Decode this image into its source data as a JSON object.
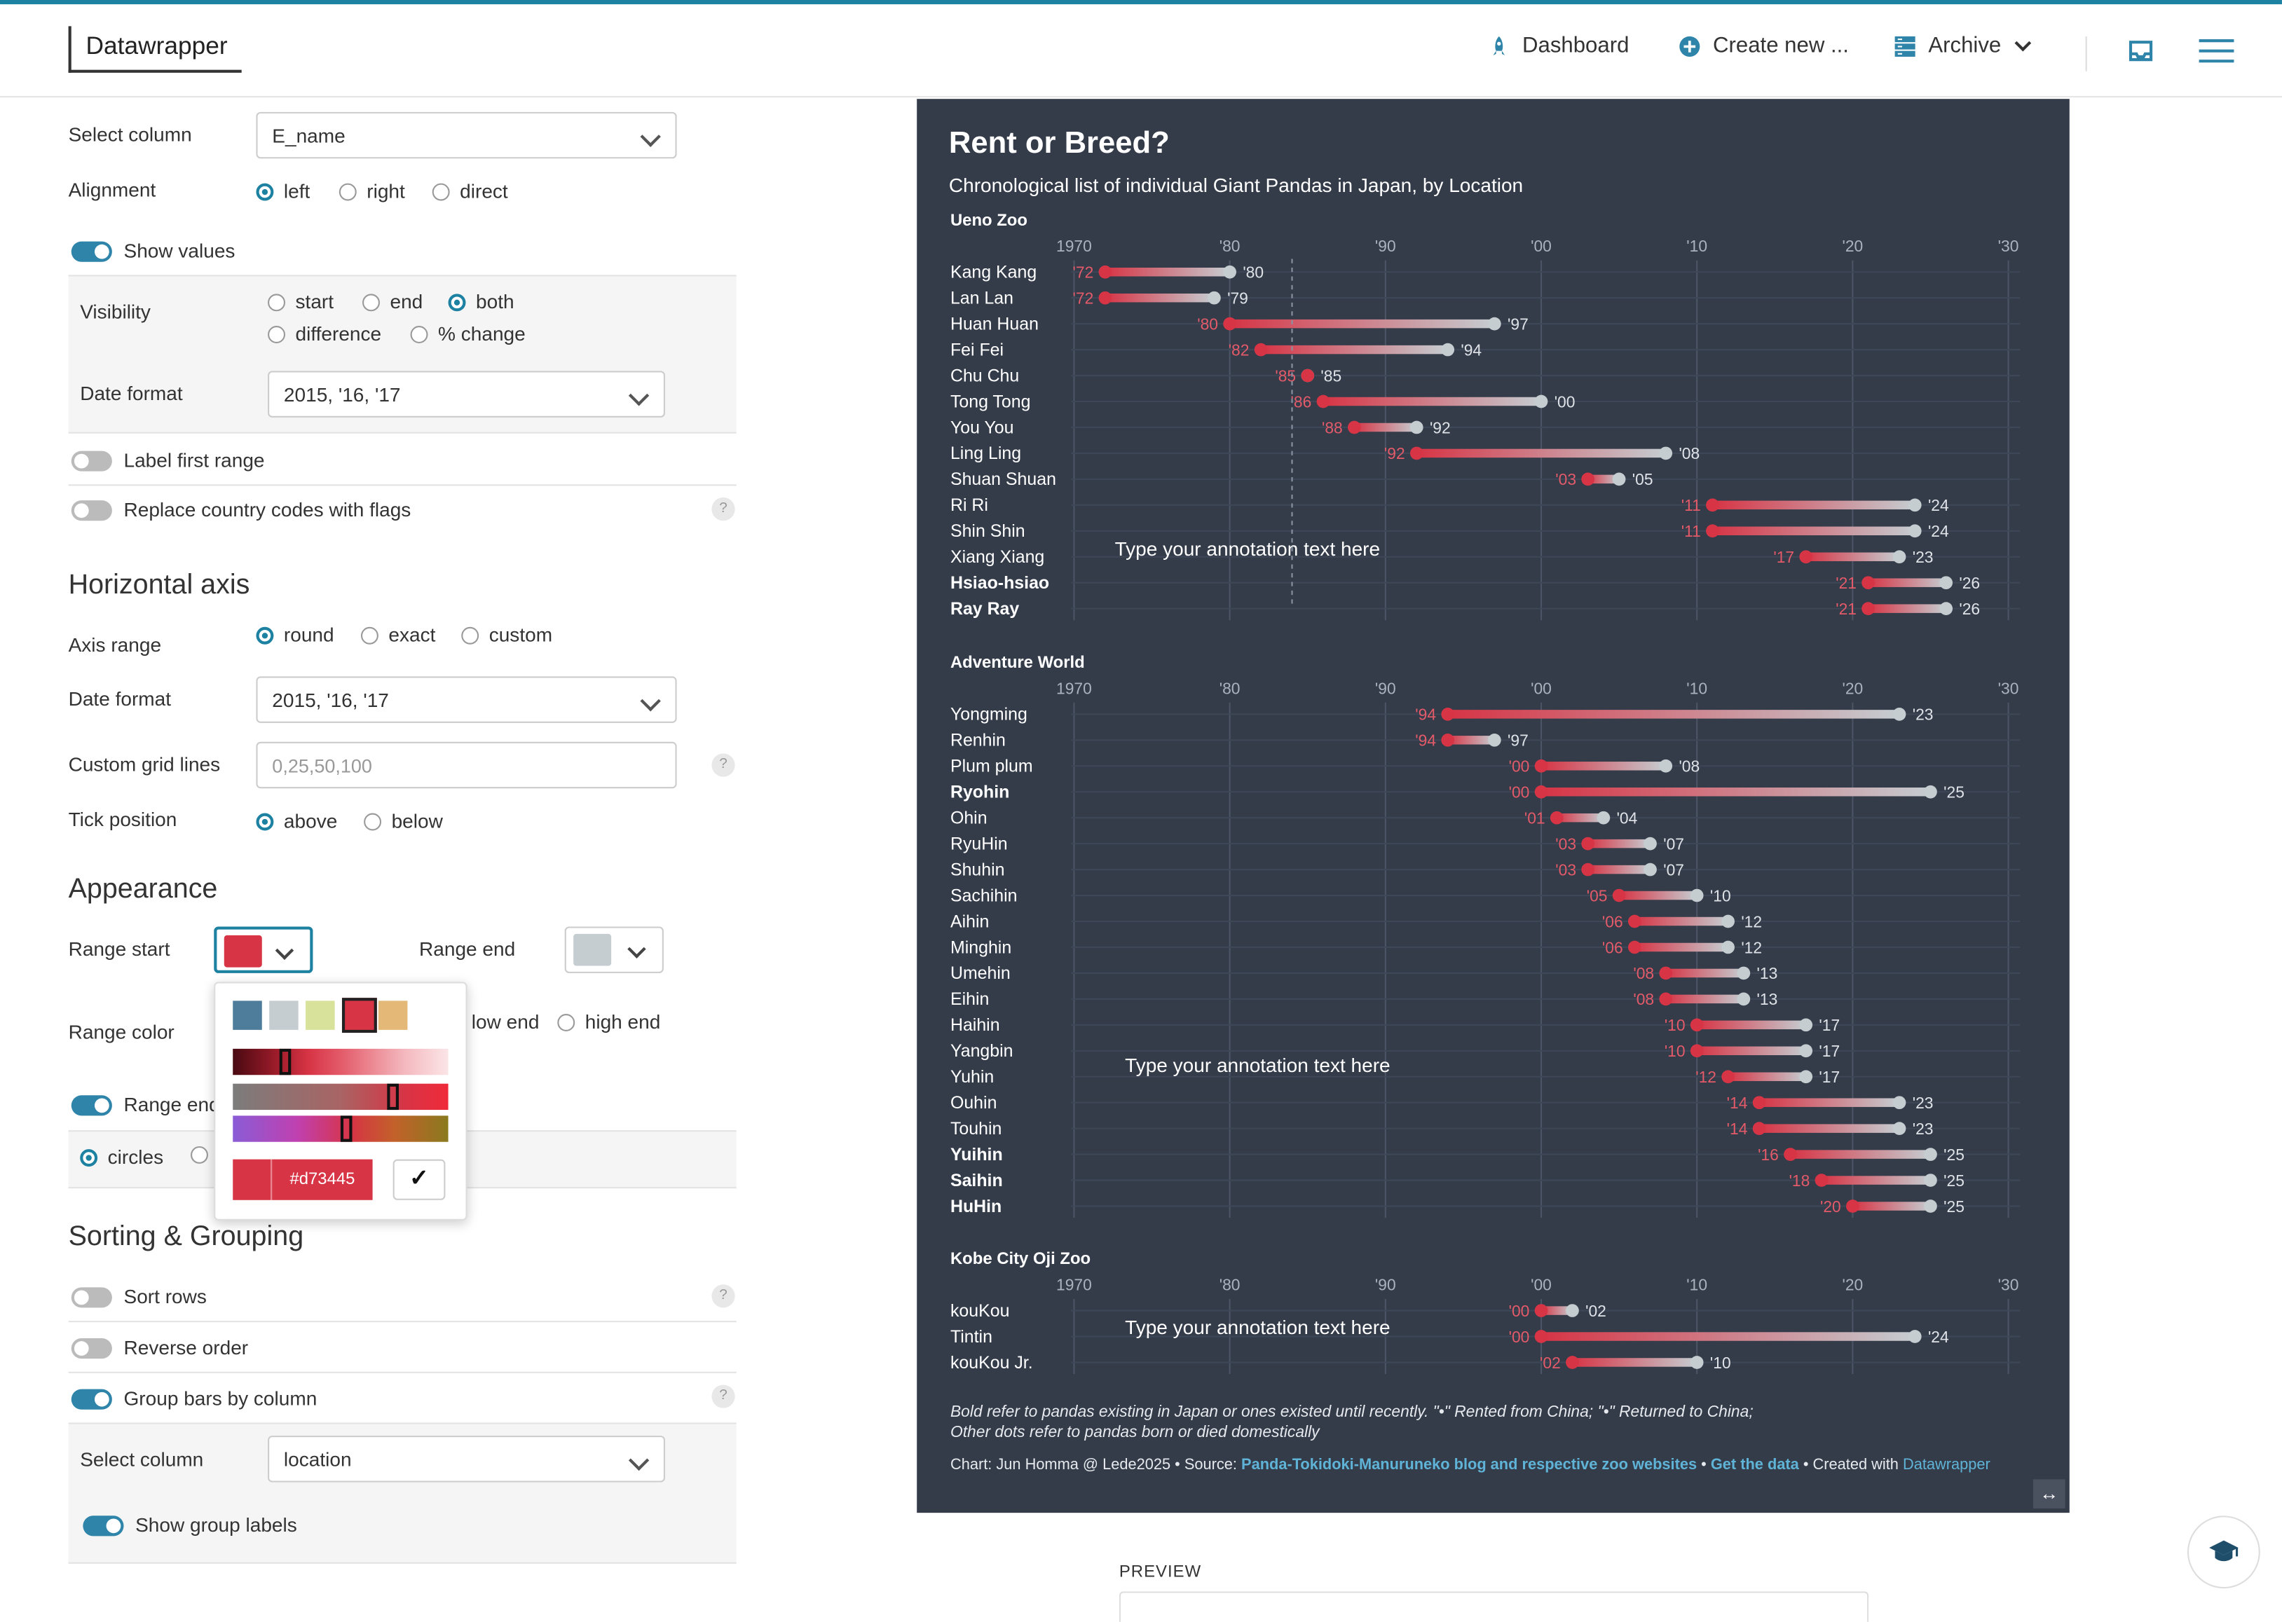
{
  "app": {
    "logo": "Datawrapper",
    "nav": {
      "dashboard": "Dashboard",
      "create_new": "Create new ...",
      "archive": "Archive"
    }
  },
  "panel": {
    "select_column_label": "Select column",
    "select_column_value": "E_name",
    "alignment": {
      "label": "Alignment",
      "options": [
        "left",
        "right",
        "direct"
      ],
      "selected": "left"
    },
    "show_values": {
      "label": "Show values",
      "on": true
    },
    "visibility": {
      "label": "Visibility",
      "options": [
        "start",
        "end",
        "both",
        "difference",
        "% change"
      ],
      "selected": "both"
    },
    "date_format_label": "Date format",
    "date_format_value": "2015, '16, '17",
    "label_first_range": {
      "label": "Label first range",
      "on": false
    },
    "replace_flags": {
      "label": "Replace country codes with flags",
      "on": false
    },
    "help": "?",
    "horizontal_axis": {
      "title": "Horizontal axis",
      "axis_range": {
        "label": "Axis range",
        "options": [
          "round",
          "exact",
          "custom"
        ],
        "selected": "round"
      },
      "date_format_label": "Date format",
      "date_format_value": "2015, '16, '17",
      "grid_lines_label": "Custom grid lines",
      "grid_lines_placeholder": "0,25,50,100",
      "tick_position": {
        "label": "Tick position",
        "options": [
          "above",
          "below"
        ],
        "selected": "above"
      }
    },
    "appearance": {
      "title": "Appearance",
      "range_start_label": "Range start",
      "range_start_color": "#d73445",
      "range_end_label": "Range end",
      "range_end_color": "#c5cdd1",
      "range_color_label": "Range color",
      "range_color_options": [
        "low end",
        "high end"
      ],
      "range_end_toggle_label": "Range end",
      "dot_style": "circles"
    },
    "picker": {
      "palette": [
        "#4e7d9c",
        "#c5cdd1",
        "#d9e29a",
        "#d73445",
        "#e4b876"
      ],
      "hex": "#d73445",
      "confirm": "✓"
    },
    "sorting": {
      "title": "Sorting & Grouping",
      "sort_rows": {
        "label": "Sort rows",
        "on": false
      },
      "reverse_order": {
        "label": "Reverse order",
        "on": false
      },
      "group_bars": {
        "label": "Group bars by column",
        "on": true
      },
      "select_column_label": "Select column",
      "select_column_value": "location",
      "show_group_labels": {
        "label": "Show group labels",
        "on": true
      }
    }
  },
  "preview_label": "PREVIEW",
  "chart_data": {
    "type": "range-plot",
    "title": "Rent or Breed?",
    "subtitle": "Chronological list of individual Giant Pandas in Japan, by Location",
    "ticks": [
      "1970",
      "'80",
      "'90",
      "'00",
      "'10",
      "'20",
      "'30"
    ],
    "xlim": [
      1970,
      2030
    ],
    "colors": {
      "start": "#d73445",
      "end": "#c5cdd1",
      "background": "#343c4a"
    },
    "annotation": "Type your annotation text here",
    "groups": [
      {
        "name": "Ueno Zoo",
        "rows": [
          {
            "name": "Kang Kang",
            "start": 1972,
            "end": 1980,
            "s": "'72",
            "e": "'80",
            "bold": false
          },
          {
            "name": "Lan Lan",
            "start": 1972,
            "end": 1979,
            "s": "'72",
            "e": "'79",
            "bold": false
          },
          {
            "name": "Huan Huan",
            "start": 1980,
            "end": 1997,
            "s": "'80",
            "e": "'97",
            "bold": false
          },
          {
            "name": "Fei Fei",
            "start": 1982,
            "end": 1994,
            "s": "'82",
            "e": "'94",
            "bold": false
          },
          {
            "name": "Chu Chu",
            "start": 1985,
            "end": 1985,
            "s": "'85",
            "e": "'85",
            "bold": false
          },
          {
            "name": "Tong Tong",
            "start": 1986,
            "end": 2000,
            "s": "'86",
            "e": "'00",
            "bold": false
          },
          {
            "name": "You You",
            "start": 1988,
            "end": 1992,
            "s": "'88",
            "e": "'92",
            "bold": false
          },
          {
            "name": "Ling Ling",
            "start": 1992,
            "end": 2008,
            "s": "'92",
            "e": "'08",
            "bold": false
          },
          {
            "name": "Shuan Shuan",
            "start": 2003,
            "end": 2005,
            "s": "'03",
            "e": "'05",
            "bold": false
          },
          {
            "name": "Ri Ri",
            "start": 2011,
            "end": 2024,
            "s": "'11",
            "e": "'24",
            "bold": false
          },
          {
            "name": "Shin Shin",
            "start": 2011,
            "end": 2024,
            "s": "'11",
            "e": "'24",
            "bold": false
          },
          {
            "name": "Xiang Xiang",
            "start": 2017,
            "end": 2023,
            "s": "'17",
            "e": "'23",
            "bold": false
          },
          {
            "name": "Hsiao-hsiao",
            "start": 2021,
            "end": 2026,
            "s": "'21",
            "e": "'26",
            "bold": true
          },
          {
            "name": "Ray Ray",
            "start": 2021,
            "end": 2026,
            "s": "'21",
            "e": "'26",
            "bold": true
          }
        ]
      },
      {
        "name": "Adventure World",
        "rows": [
          {
            "name": "Yongming",
            "start": 1994,
            "end": 2023,
            "s": "'94",
            "e": "'23",
            "bold": false
          },
          {
            "name": "Renhin",
            "start": 1994,
            "end": 1997,
            "s": "'94",
            "e": "'97",
            "bold": false
          },
          {
            "name": "Plum plum",
            "start": 2000,
            "end": 2008,
            "s": "'00",
            "e": "'08",
            "bold": false
          },
          {
            "name": "Ryohin",
            "start": 2000,
            "end": 2025,
            "s": "'00",
            "e": "'25",
            "bold": true
          },
          {
            "name": "Ohin",
            "start": 2001,
            "end": 2004,
            "s": "'01",
            "e": "'04",
            "bold": false
          },
          {
            "name": "RyuHin",
            "start": 2003,
            "end": 2007,
            "s": "'03",
            "e": "'07",
            "bold": false
          },
          {
            "name": "Shuhin",
            "start": 2003,
            "end": 2007,
            "s": "'03",
            "e": "'07",
            "bold": false
          },
          {
            "name": "Sachihin",
            "start": 2005,
            "end": 2010,
            "s": "'05",
            "e": "'10",
            "bold": false
          },
          {
            "name": "Aihin",
            "start": 2006,
            "end": 2012,
            "s": "'06",
            "e": "'12",
            "bold": false
          },
          {
            "name": "Minghin",
            "start": 2006,
            "end": 2012,
            "s": "'06",
            "e": "'12",
            "bold": false
          },
          {
            "name": "Umehin",
            "start": 2008,
            "end": 2013,
            "s": "'08",
            "e": "'13",
            "bold": false
          },
          {
            "name": "Eihin",
            "start": 2008,
            "end": 2013,
            "s": "'08",
            "e": "'13",
            "bold": false
          },
          {
            "name": "Haihin",
            "start": 2010,
            "end": 2017,
            "s": "'10",
            "e": "'17",
            "bold": false
          },
          {
            "name": "Yangbin",
            "start": 2010,
            "end": 2017,
            "s": "'10",
            "e": "'17",
            "bold": false
          },
          {
            "name": "Yuhin",
            "start": 2012,
            "end": 2017,
            "s": "'12",
            "e": "'17",
            "bold": false
          },
          {
            "name": "Ouhin",
            "start": 2014,
            "end": 2023,
            "s": "'14",
            "e": "'23",
            "bold": false
          },
          {
            "name": "Touhin",
            "start": 2014,
            "end": 2023,
            "s": "'14",
            "e": "'23",
            "bold": false
          },
          {
            "name": "Yuihin",
            "start": 2016,
            "end": 2025,
            "s": "'16",
            "e": "'25",
            "bold": true
          },
          {
            "name": "Saihin",
            "start": 2018,
            "end": 2025,
            "s": "'18",
            "e": "'25",
            "bold": true
          },
          {
            "name": "HuHin",
            "start": 2020,
            "end": 2025,
            "s": "'20",
            "e": "'25",
            "bold": true
          }
        ]
      },
      {
        "name": "Kobe City Oji Zoo",
        "rows": [
          {
            "name": "kouKou",
            "start": 2000,
            "end": 2002,
            "s": "'00",
            "e": "'02",
            "bold": false
          },
          {
            "name": "Tintin",
            "start": 2000,
            "end": 2024,
            "s": "'00",
            "e": "'24",
            "bold": false
          },
          {
            "name": "kouKou Jr.",
            "start": 2002,
            "end": 2010,
            "s": "'02",
            "e": "'10",
            "bold": false
          }
        ]
      }
    ],
    "notes": "Bold refer to pandas existing in Japan or ones existed until recently. \"•\" Rented from China; \"•\" Returned to China; Other dots refer to pandas born or died domestically",
    "footer": {
      "chart_by": "Chart: Jun Homma @ Lede2025",
      "source_label": "Source:",
      "source": "Panda-Tokidoki-Manuruneko blog and respective zoo websites",
      "get_data": "Get the data",
      "created_with_label": "Created with",
      "created_with": "Datawrapper"
    }
  }
}
